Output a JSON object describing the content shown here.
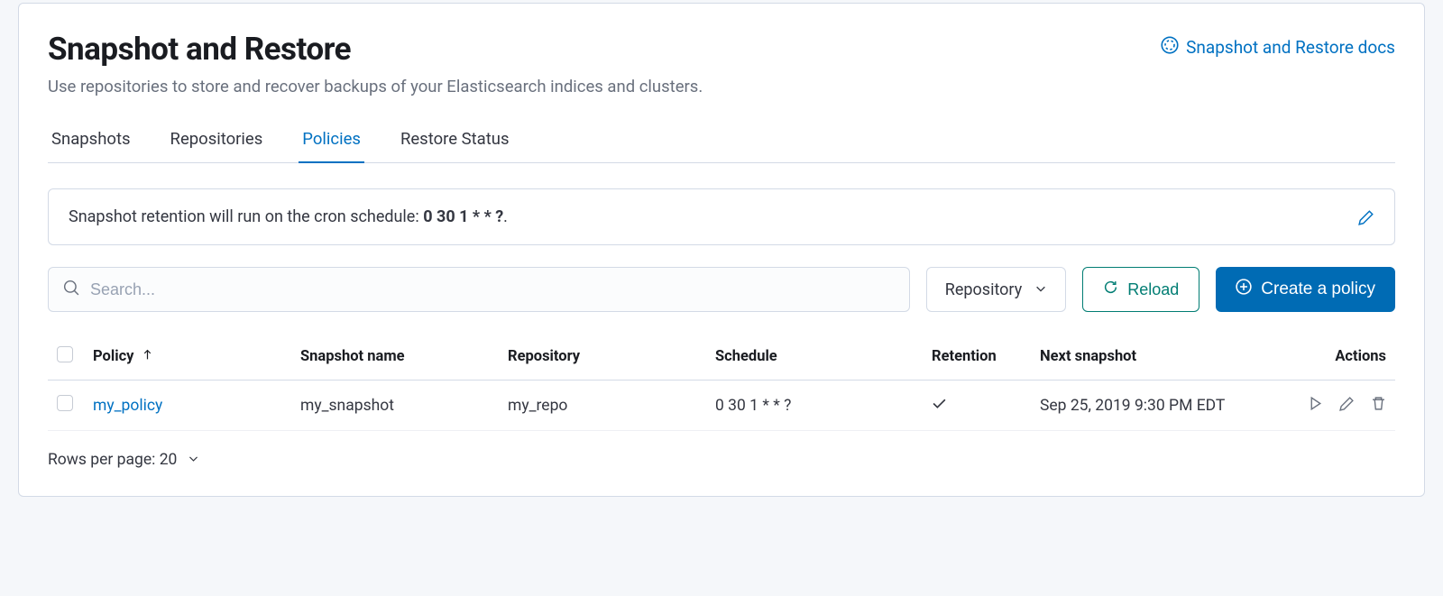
{
  "header": {
    "title": "Snapshot and Restore",
    "subtitle": "Use repositories to store and recover backups of your Elasticsearch indices and clusters.",
    "docs_link": "Snapshot and Restore docs"
  },
  "tabs": {
    "snapshots": "Snapshots",
    "repositories": "Repositories",
    "policies": "Policies",
    "restore_status": "Restore Status"
  },
  "callout": {
    "text_prefix": "Snapshot retention will run on the cron schedule: ",
    "cron": "0 30 1 * * ?",
    "text_suffix": "."
  },
  "toolbar": {
    "search_placeholder": "Search...",
    "repository_filter": "Repository",
    "reload_label": "Reload",
    "create_label": "Create a policy"
  },
  "table": {
    "headers": {
      "policy": "Policy",
      "snapshot_name": "Snapshot name",
      "repository": "Repository",
      "schedule": "Schedule",
      "retention": "Retention",
      "next_snapshot": "Next snapshot",
      "actions": "Actions"
    },
    "rows": [
      {
        "policy": "my_policy",
        "snapshot_name": "my_snapshot",
        "repository": "my_repo",
        "schedule": "0 30 1 * * ?",
        "retention": "check",
        "next_snapshot": "Sep 25, 2019 9:30 PM EDT"
      }
    ]
  },
  "pager": {
    "label": "Rows per page: 20"
  }
}
